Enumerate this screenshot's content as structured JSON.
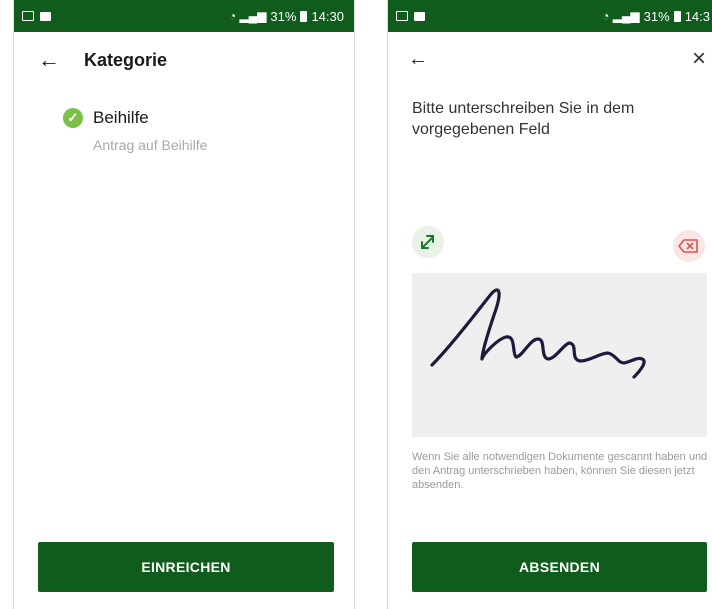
{
  "left": {
    "status": {
      "battery": "31%",
      "time": "14:30"
    },
    "header": {
      "title": "Kategorie"
    },
    "item": {
      "label": "Beihilfe",
      "sublabel": "Antrag auf Beihilfe"
    },
    "button": {
      "label": "EINREICHEN"
    }
  },
  "right": {
    "status": {
      "battery": "31%",
      "time": "14:3"
    },
    "instruction": "Bitte unterschreiben Sie in dem vorgegebenen Feld",
    "helper": "Wenn Sie alle notwendigen Dokumente gescannt haben und den Antrag unterschrieben haben, können Sie diesen jetzt absenden.",
    "button": {
      "label": "ABSENDEN"
    }
  },
  "icons": {
    "expand": "expand-icon",
    "erase": "backspace-clear-icon",
    "back": "arrow-left-icon",
    "close": "close-icon",
    "check": "check-circle-icon"
  },
  "colors": {
    "primary": "#0f5c1c",
    "check": "#7cc04a",
    "erase": "#d9534f",
    "signature_area": "#efefef",
    "ink": "#1c1c3a"
  }
}
